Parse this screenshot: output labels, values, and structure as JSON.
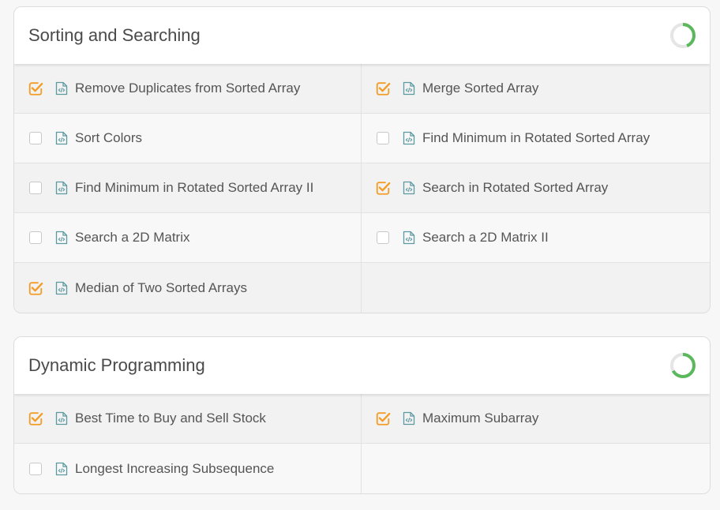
{
  "sections": [
    {
      "title": "Sorting and Searching",
      "progress": 0.44,
      "items": [
        {
          "label": "Remove Duplicates from Sorted Array",
          "checked": true
        },
        {
          "label": "Merge Sorted Array",
          "checked": true
        },
        {
          "label": "Sort Colors",
          "checked": false
        },
        {
          "label": "Find Minimum in Rotated Sorted Array",
          "checked": false
        },
        {
          "label": "Find Minimum in Rotated Sorted Array II",
          "checked": false
        },
        {
          "label": "Search in Rotated Sorted Array",
          "checked": true
        },
        {
          "label": "Search a 2D Matrix",
          "checked": false
        },
        {
          "label": "Search a 2D Matrix II",
          "checked": false
        },
        {
          "label": "Median of Two Sorted Arrays",
          "checked": true
        }
      ]
    },
    {
      "title": "Dynamic Programming",
      "progress": 0.67,
      "items": [
        {
          "label": "Best Time to Buy and Sell Stock",
          "checked": true
        },
        {
          "label": "Maximum Subarray",
          "checked": true
        },
        {
          "label": "Longest Increasing Subsequence",
          "checked": false
        }
      ]
    }
  ],
  "colors": {
    "check_orange": "#f39c26",
    "progress_green": "#5cb85c",
    "progress_track": "#e5e5e5",
    "file_icon_teal": "#5b9aa0"
  },
  "icons": {
    "checked": "checkbox-checked-icon",
    "unchecked": "checkbox-unchecked-icon",
    "file": "code-file-icon",
    "progress": "progress-ring-icon"
  }
}
